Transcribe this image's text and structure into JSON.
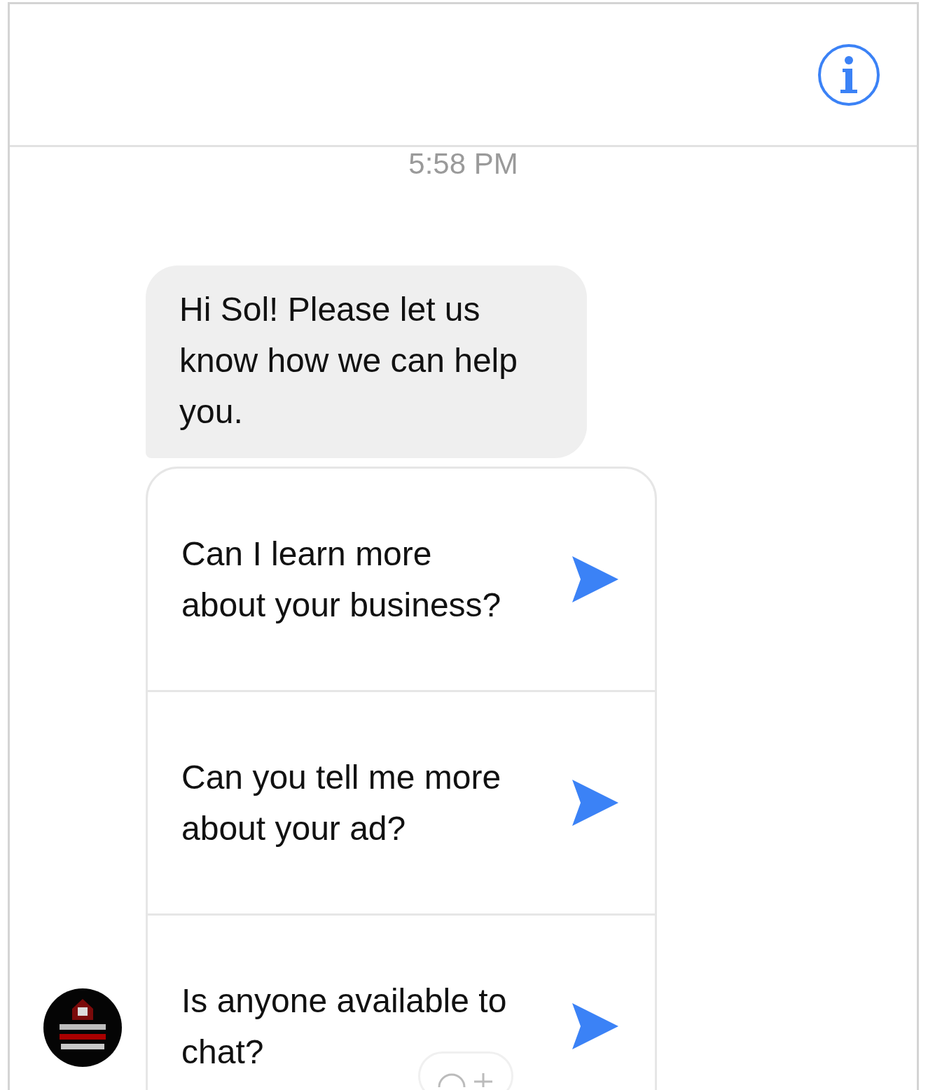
{
  "timestamp": "5:58 PM",
  "message": {
    "text": "Hi Sol! Please let us know how we can help you."
  },
  "quick_replies": [
    {
      "text": "Can I learn more about your business?"
    },
    {
      "text": "Can you tell me more about your ad?"
    },
    {
      "text": "Is anyone available to chat?"
    }
  ]
}
